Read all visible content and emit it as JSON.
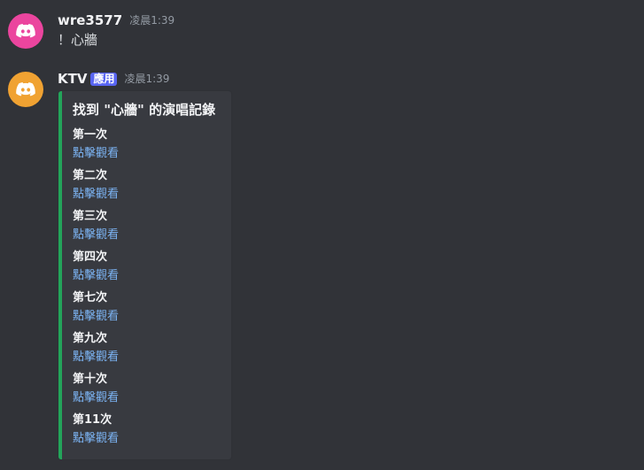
{
  "messages": [
    {
      "username": "wre3577",
      "timestamp": "凌晨1:39",
      "content": "！心牆",
      "avatar_color": "#eb459e",
      "avatar_icon": "discord-logo-icon"
    },
    {
      "username": "KTV",
      "badge": "應用",
      "timestamp": "凌晨1:39",
      "avatar_color": "#f0a232",
      "avatar_icon": "discord-logo-icon",
      "embed": {
        "accent_color": "#23a55a",
        "title": "找到 \"心牆\" 的演唱記錄",
        "fields": [
          {
            "name": "第一次",
            "value": "點擊觀看"
          },
          {
            "name": "第二次",
            "value": "點擊觀看"
          },
          {
            "name": "第三次",
            "value": "點擊觀看"
          },
          {
            "name": "第四次",
            "value": "點擊觀看"
          },
          {
            "name": "第七次",
            "value": "點擊觀看"
          },
          {
            "name": "第九次",
            "value": "點擊觀看"
          },
          {
            "name": "第十次",
            "value": "點擊觀看"
          },
          {
            "name": "第11次",
            "value": "點擊觀看"
          }
        ]
      }
    }
  ]
}
